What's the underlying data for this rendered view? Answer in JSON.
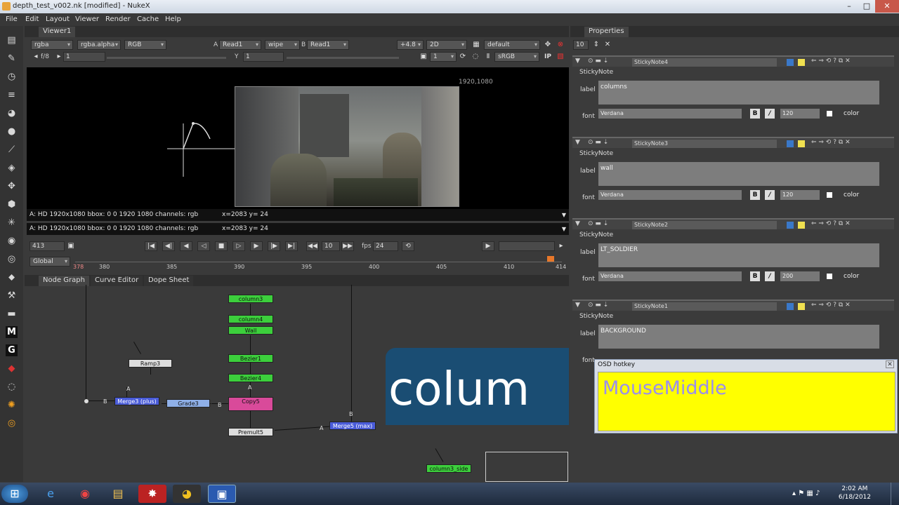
{
  "window": {
    "title": "depth_test_v002.nk [modified] - NukeX"
  },
  "menu": [
    "File",
    "Edit",
    "Layout",
    "Viewer",
    "Render",
    "Cache",
    "Help"
  ],
  "viewer": {
    "tab": "Viewer1",
    "channels": "rgba",
    "alpha": "rgba.alpha",
    "display": "RGB",
    "a_label": "A",
    "a_input": "Read1",
    "wipe": "wipe",
    "b_label": "B",
    "b_input": "Read1",
    "gain": "+4.8",
    "mode": "2D",
    "lut": "default",
    "fstop": "f/8",
    "frame_field": "1",
    "y_label": "Y",
    "y_field": "1",
    "proxy": "1",
    "colorspace": "sRGB",
    "ip": "IP",
    "format_label": "1920,1080",
    "info1": "A: HD 1920x1080 bbox: 0 0 1920 1080 channels: rgb",
    "coord1": "x=2083 y=  24",
    "info2": "A: HD 1920x1080 bbox: 0 0 1920 1080 channels: rgb",
    "coord2": "x=2083 y=  24",
    "current_frame": "413",
    "step": "10",
    "fps_label": "fps",
    "fps": "24",
    "timeline_mode": "Global",
    "ticks": [
      "378",
      "380",
      "385",
      "390",
      "395",
      "400",
      "405",
      "410",
      "414"
    ]
  },
  "nodegraph": {
    "tabs": [
      "Node Graph",
      "Curve Editor",
      "Dope Sheet"
    ],
    "nodes": {
      "column3": "column3",
      "column4": "column4",
      "wall": "Wall",
      "ramp3": "Ramp3",
      "bezier1": "Bezier1",
      "bezier4": "Bezier4",
      "copy5": "Copy5",
      "merge": "Merge3 (plus)",
      "grade3": "Grade3",
      "premult5": "Premult5",
      "merge_max": "Merge5 (max)",
      "column3_side": "column3_side"
    },
    "sticky_text": "colum"
  },
  "properties": {
    "title": "Properties",
    "max_panels": "10",
    "panels": [
      {
        "name": "StickyNote4",
        "tab": "StickyNote",
        "label_caption": "label",
        "label": "columns",
        "font_caption": "font",
        "font": "Verdana",
        "size": "120",
        "color_caption": "color"
      },
      {
        "name": "StickyNote3",
        "tab": "StickyNote",
        "label_caption": "label",
        "label": "wall",
        "font_caption": "font",
        "font": "Verdana",
        "size": "120",
        "color_caption": "color"
      },
      {
        "name": "StickyNote2",
        "tab": "StickyNote",
        "label_caption": "label",
        "label": "LT_SOLDIER",
        "font_caption": "font",
        "font": "Verdana",
        "size": "200",
        "color_caption": "color"
      },
      {
        "name": "StickyNote1",
        "tab": "StickyNote",
        "label_caption": "label",
        "label": "BACKGROUND",
        "font_caption": "font"
      }
    ]
  },
  "osd": {
    "title": "OSD hotkey",
    "text": "MouseMiddle"
  },
  "taskbar": {
    "time": "2:02 AM",
    "date": "6/18/2012"
  },
  "colors": {
    "accent": "#ffff00",
    "node_green": "#3ccf3c",
    "node_pink": "#d94a9a",
    "node_blue": "#4a5cd8",
    "sticky_blue": "#1a4d73"
  }
}
